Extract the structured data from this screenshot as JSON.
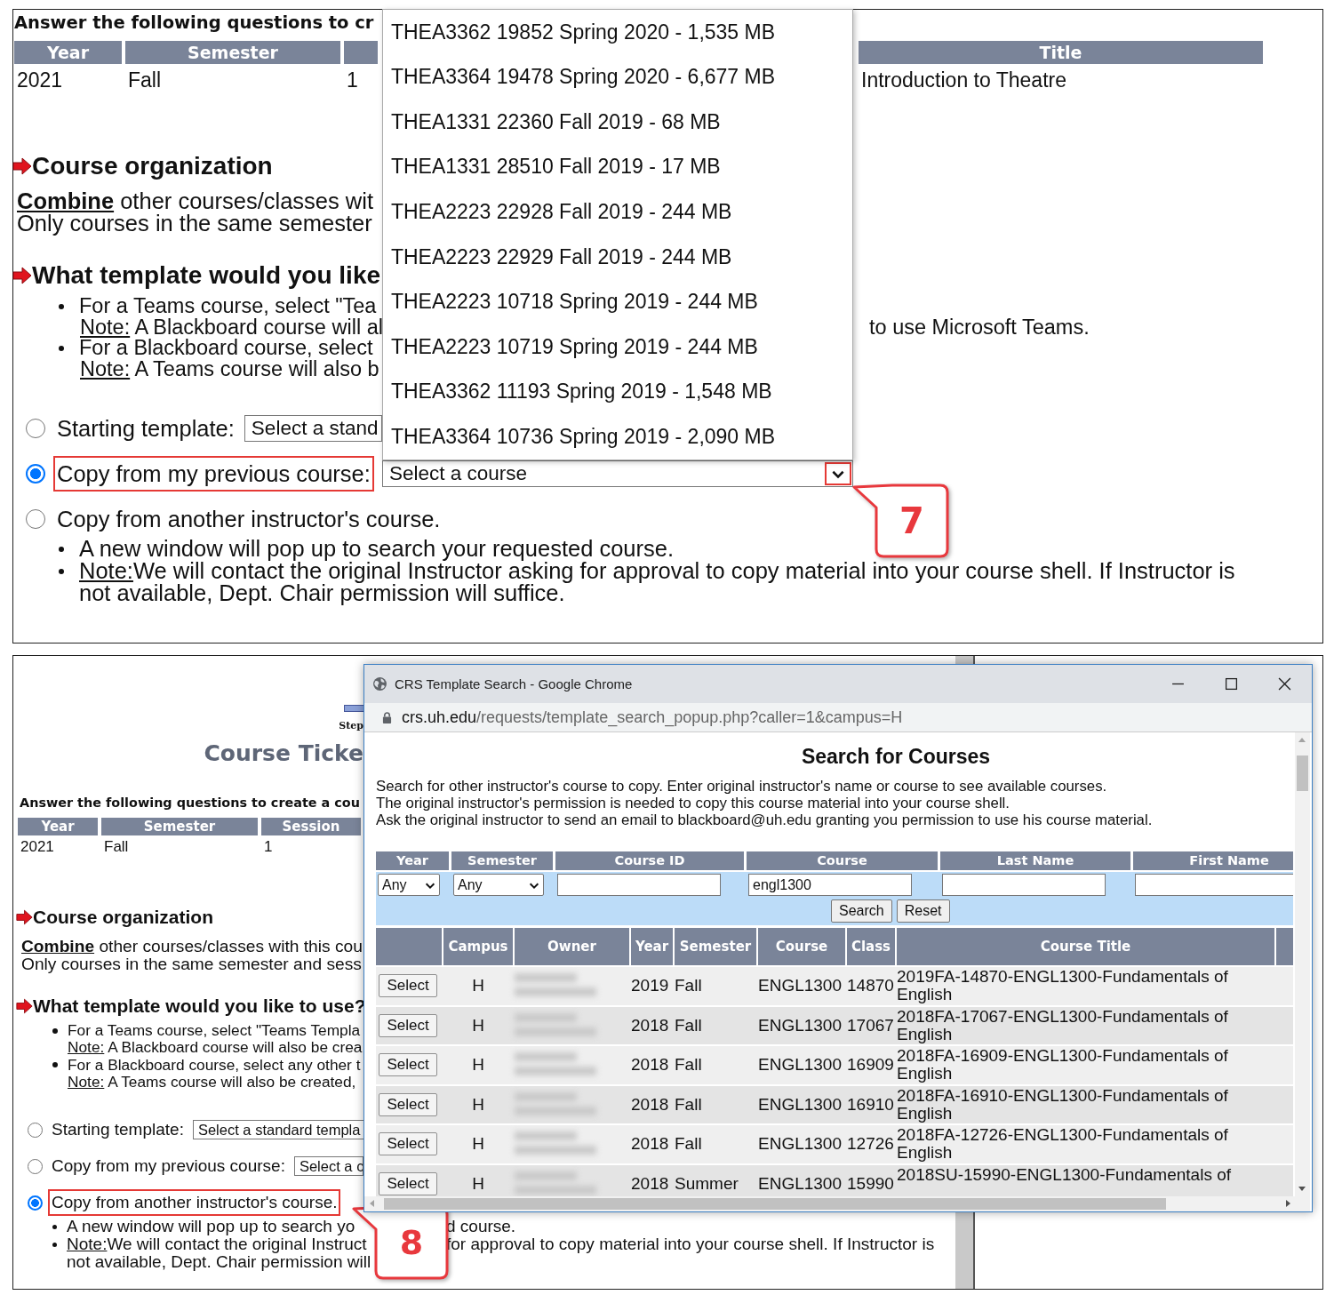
{
  "step7": {
    "intro": "Answer the following questions to cr",
    "info_columns": [
      "Year",
      "Semester"
    ],
    "info_row": [
      "2021",
      "Fall",
      "1"
    ],
    "title_column": {
      "label": "Title",
      "value": "Introduction to Theatre"
    },
    "org_heading": "Course organization",
    "combine_link": "Combine",
    "combine_rest": "other courses/classes wit",
    "same_semester": "Only courses in the same semester",
    "template_heading": "What template would you like",
    "template_bullets": [
      {
        "text": "For a Teams course, select \"Tea",
        "note_label": "Note:",
        "note": "A Blackboard course will al",
        "note_tail": "to use Microsoft Teams."
      },
      {
        "text": "For a Blackboard course, select",
        "note_label": "Note:",
        "note": "A Teams course will also b"
      }
    ],
    "options": [
      {
        "label": "Starting template:",
        "selected": false,
        "highlighted": false,
        "select": {
          "value": "Select a stand"
        }
      },
      {
        "label": "Copy from my previous course:",
        "selected": true,
        "highlighted": true,
        "select": {
          "value": "Select a course",
          "arrow_highlighted": true,
          "open": true,
          "options": [
            "THEA3362 19852 Spring 2020 - 1,535 MB",
            "THEA3364 19478 Spring 2020 - 6,677 MB",
            "THEA1331 22360 Fall 2019 - 68 MB",
            "THEA1331 28510 Fall 2019 - 17 MB",
            "THEA2223 22928 Fall 2019 - 244 MB",
            "THEA2223 22929 Fall 2019 - 244 MB",
            "THEA2223 10718 Spring 2019 - 244 MB",
            "THEA2223 10719 Spring 2019 - 244 MB",
            "THEA3362 11193 Spring 2019 - 1,548 MB",
            "THEA3364 10736 Spring 2019 - 2,090 MB"
          ]
        }
      },
      {
        "label": "Copy from another instructor's course.",
        "selected": false,
        "highlighted": false
      }
    ],
    "bullets": [
      {
        "text": "A new window will pop up to search your requested course."
      },
      {
        "note_label": "Note:",
        "text": "We will contact the original Instructor asking for approval to copy material into your course shell. If Instructor is not available, Dept. Chair permission will suffice."
      }
    ],
    "callout": "7"
  },
  "step8": {
    "ticket": {
      "step": "Step",
      "title": "Course Ticke"
    },
    "intro": "Answer the following questions to create a cou",
    "info_columns": [
      "Year",
      "Semester",
      "Session"
    ],
    "info_row": [
      "2021",
      "Fall",
      "1"
    ],
    "org_heading": "Course organization",
    "combine_link": "Combine",
    "combine_rest": "other courses/classes with this cou",
    "same_semester": "Only courses in the same semester and sess",
    "template_heading": "What template would you like to use?",
    "template_bullets": [
      {
        "text": "For a Teams course, select \"Teams Templa",
        "note_label": "Note:",
        "note": "A Blackboard course will also be crea"
      },
      {
        "text": "For a Blackboard course, select any other t",
        "note_label": "Note:",
        "note": "A Teams course will also be created,"
      }
    ],
    "options": [
      {
        "label": "Starting template:",
        "selected": false,
        "highlighted": false,
        "select": {
          "value": "Select a standard templa"
        }
      },
      {
        "label": "Copy from my previous course:",
        "selected": false,
        "highlighted": false,
        "select": {
          "value": "Select a c"
        }
      },
      {
        "label": "Copy from another instructor's course.",
        "selected": true,
        "highlighted": true
      }
    ],
    "bullets": [
      {
        "lines": [
          [
            "A new window will pop up to search yo",
            "d course."
          ]
        ]
      },
      {
        "note_label": "Note:",
        "lines": [
          [
            "We will contact the original Instruct",
            "for approval to copy material into your course shell. If Instructor is"
          ],
          [
            "not available, Dept. Chair permission will"
          ]
        ]
      }
    ],
    "callout": "8",
    "popup": {
      "window_title": "CRS Template Search - Google Chrome",
      "url_host": "crs.uh.edu",
      "url_path": "/requests/template_search_popup.php?caller=1&campus=H",
      "heading": "Search for Courses",
      "description": [
        "Search for other instructor's course to copy. Enter original instructor's name or course to see available courses.",
        "The original instructor's permission is needed to copy this course material into your course shell.",
        "Ask the original instructor to send an email to blackboard@uh.edu granting you permission to use his course material."
      ],
      "search_form": {
        "columns": [
          "Year",
          "Semester",
          "Course ID",
          "Course",
          "Last Name",
          "First Name"
        ],
        "fields": [
          {
            "kind": "select",
            "value": "Any"
          },
          {
            "kind": "select",
            "value": "Any"
          },
          {
            "kind": "input"
          },
          {
            "kind": "input",
            "value": "engl1300"
          },
          {
            "kind": "input"
          },
          {
            "kind": "input"
          }
        ],
        "buttons": [
          "Search",
          "Reset"
        ]
      },
      "results": {
        "columns": [
          {
            "kind": "action"
          },
          {
            "kind": "campus",
            "label": "Campus"
          },
          {
            "kind": "owner",
            "label": "Owner"
          },
          {
            "kind": "year",
            "label": "Year"
          },
          {
            "kind": "semester",
            "label": "Semester"
          },
          {
            "kind": "course",
            "label": "Course"
          },
          {
            "kind": "class",
            "label": "Class"
          },
          {
            "kind": "title",
            "label": "Course Title"
          }
        ],
        "rows": [
          {
            "action": "Select",
            "campus": "H",
            "year": "2019",
            "semester": "Fall",
            "course": "ENGL1300",
            "class": "14870",
            "title": "2019FA-14870-ENGL1300-Fundamentals of English"
          },
          {
            "action": "Select",
            "campus": "H",
            "year": "2018",
            "semester": "Fall",
            "course": "ENGL1300",
            "class": "17067",
            "title": "2018FA-17067-ENGL1300-Fundamentals of English"
          },
          {
            "action": "Select",
            "campus": "H",
            "year": "2018",
            "semester": "Fall",
            "course": "ENGL1300",
            "class": "16909",
            "title": "2018FA-16909-ENGL1300-Fundamentals of English"
          },
          {
            "action": "Select",
            "campus": "H",
            "year": "2018",
            "semester": "Fall",
            "course": "ENGL1300",
            "class": "16910",
            "title": "2018FA-16910-ENGL1300-Fundamentals of English"
          },
          {
            "action": "Select",
            "campus": "H",
            "year": "2018",
            "semester": "Fall",
            "course": "ENGL1300",
            "class": "12726",
            "title": "2018FA-12726-ENGL1300-Fundamentals of English"
          },
          {
            "action": "Select",
            "campus": "H",
            "year": "2018",
            "semester": "Summer",
            "course": "ENGL1300",
            "class": "15990",
            "title": "2018SU-15990-ENGL1300-Fundamentals of"
          }
        ]
      }
    }
  }
}
